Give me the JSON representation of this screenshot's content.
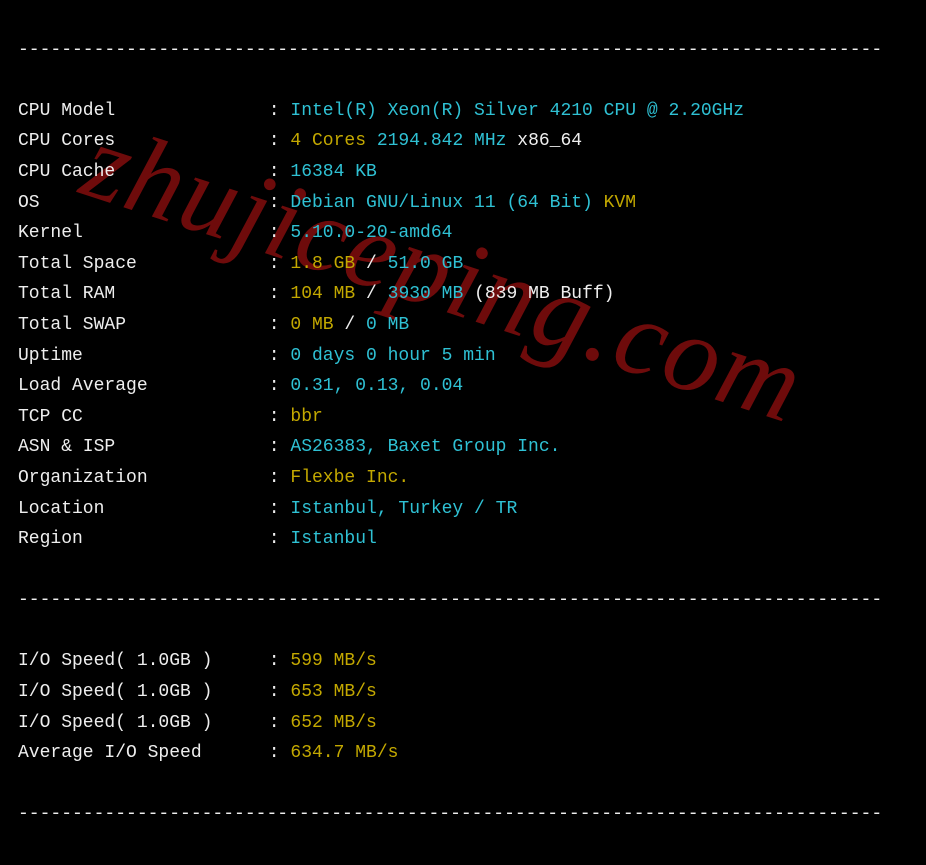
{
  "watermark": "zhujiceping.com",
  "separatorChar": "-",
  "specs": [
    {
      "label": "CPU Model",
      "parts": [
        {
          "text": "Intel(R) Xeon(R) Silver 4210 CPU @ 2.20GHz",
          "cls": "cyan"
        }
      ]
    },
    {
      "label": "CPU Cores",
      "parts": [
        {
          "text": "4 Cores ",
          "cls": "yellow"
        },
        {
          "text": "2194.842 MHz ",
          "cls": "cyan"
        },
        {
          "text": "x86_64",
          "cls": "white"
        }
      ]
    },
    {
      "label": "CPU Cache",
      "parts": [
        {
          "text": "16384 KB",
          "cls": "cyan"
        }
      ]
    },
    {
      "label": "OS",
      "parts": [
        {
          "text": "Debian GNU/Linux 11 (64 Bit) ",
          "cls": "cyan"
        },
        {
          "text": "KVM",
          "cls": "yellow"
        }
      ]
    },
    {
      "label": "Kernel",
      "parts": [
        {
          "text": "5.10.0-20-amd64",
          "cls": "cyan"
        }
      ]
    },
    {
      "label": "Total Space",
      "parts": [
        {
          "text": "1.8 GB ",
          "cls": "yellow"
        },
        {
          "text": "/ ",
          "cls": "white"
        },
        {
          "text": "51.0 GB",
          "cls": "cyan"
        }
      ]
    },
    {
      "label": "Total RAM",
      "parts": [
        {
          "text": "104 MB ",
          "cls": "yellow"
        },
        {
          "text": "/ ",
          "cls": "white"
        },
        {
          "text": "3930 MB ",
          "cls": "cyan"
        },
        {
          "text": "(839 MB Buff)",
          "cls": "white"
        }
      ]
    },
    {
      "label": "Total SWAP",
      "parts": [
        {
          "text": "0 MB ",
          "cls": "yellow"
        },
        {
          "text": "/ ",
          "cls": "white"
        },
        {
          "text": "0 MB",
          "cls": "cyan"
        }
      ]
    },
    {
      "label": "Uptime",
      "parts": [
        {
          "text": "0 days 0 hour 5 min",
          "cls": "cyan"
        }
      ]
    },
    {
      "label": "Load Average",
      "parts": [
        {
          "text": "0.31, 0.13, 0.04",
          "cls": "cyan"
        }
      ]
    },
    {
      "label": "TCP CC",
      "parts": [
        {
          "text": "bbr",
          "cls": "yellow"
        }
      ]
    },
    {
      "label": "ASN & ISP",
      "parts": [
        {
          "text": "AS26383, Baxet Group Inc.",
          "cls": "cyan"
        }
      ]
    },
    {
      "label": "Organization",
      "parts": [
        {
          "text": "Flexbe Inc.",
          "cls": "yellow"
        }
      ]
    },
    {
      "label": "Location",
      "parts": [
        {
          "text": "Istanbul, Turkey / TR",
          "cls": "cyan"
        }
      ]
    },
    {
      "label": "Region",
      "parts": [
        {
          "text": "Istanbul",
          "cls": "cyan"
        }
      ]
    }
  ],
  "io": [
    {
      "label": "I/O Speed( 1.0GB )",
      "parts": [
        {
          "text": "599 MB/s",
          "cls": "yellow"
        }
      ]
    },
    {
      "label": "I/O Speed( 1.0GB )",
      "parts": [
        {
          "text": "653 MB/s",
          "cls": "yellow"
        }
      ]
    },
    {
      "label": "I/O Speed( 1.0GB )",
      "parts": [
        {
          "text": "652 MB/s",
          "cls": "yellow"
        }
      ]
    },
    {
      "label": "Average I/O Speed",
      "parts": [
        {
          "text": "634.7 MB/s",
          "cls": "yellow"
        }
      ]
    }
  ]
}
